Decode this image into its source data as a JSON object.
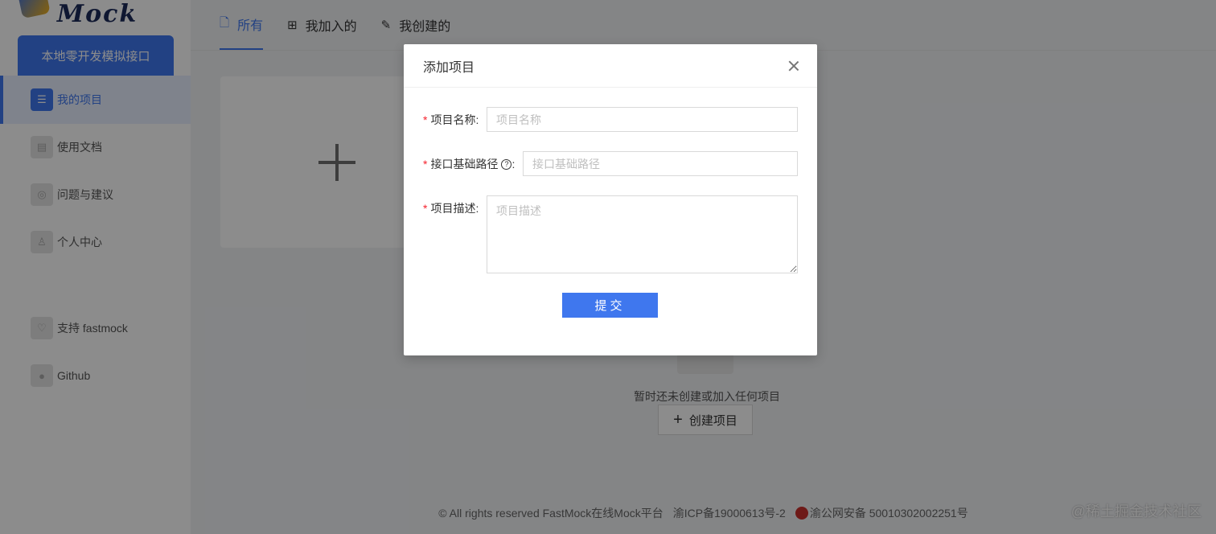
{
  "app": {
    "logo_text": "Fast Mock"
  },
  "sidebar": {
    "cta_label": "本地零开发模拟接口",
    "items": [
      {
        "label": "我的项目",
        "icon": "list-icon",
        "active": true
      },
      {
        "label": "使用文档",
        "icon": "document-icon"
      },
      {
        "label": "问题与建议",
        "icon": "feedback-icon"
      },
      {
        "label": "个人中心",
        "icon": "user-icon"
      },
      {
        "label": "支持 fastmock",
        "icon": "heart-icon"
      },
      {
        "label": "Github",
        "icon": "github-icon"
      }
    ]
  },
  "tabs": [
    {
      "label": "所有",
      "icon": "file-icon",
      "active": true
    },
    {
      "label": "我加入的",
      "icon": "file-add-icon"
    },
    {
      "label": "我创建的",
      "icon": "edit-icon"
    }
  ],
  "empty_state": {
    "text": "暂时还未创建或加入任何项目",
    "create_label": "创建项目"
  },
  "footer": {
    "copyright": "© All rights reserved FastMock在线Mock平台",
    "icp": "渝ICP备19000613号-2",
    "police": "渝公网安备 50010302002251号"
  },
  "watermark": "@稀土掘金技术社区",
  "modal": {
    "title": "添加项目",
    "fields": {
      "name": {
        "label": "项目名称",
        "placeholder": "项目名称",
        "value": ""
      },
      "base_path": {
        "label": "接口基础路径",
        "placeholder": "接口基础路径",
        "value": ""
      },
      "description": {
        "label": "项目描述",
        "placeholder": "项目描述",
        "value": ""
      }
    },
    "submit_label": "提交"
  },
  "colors": {
    "primary": "#3f77ee",
    "required": "#f5222d"
  }
}
